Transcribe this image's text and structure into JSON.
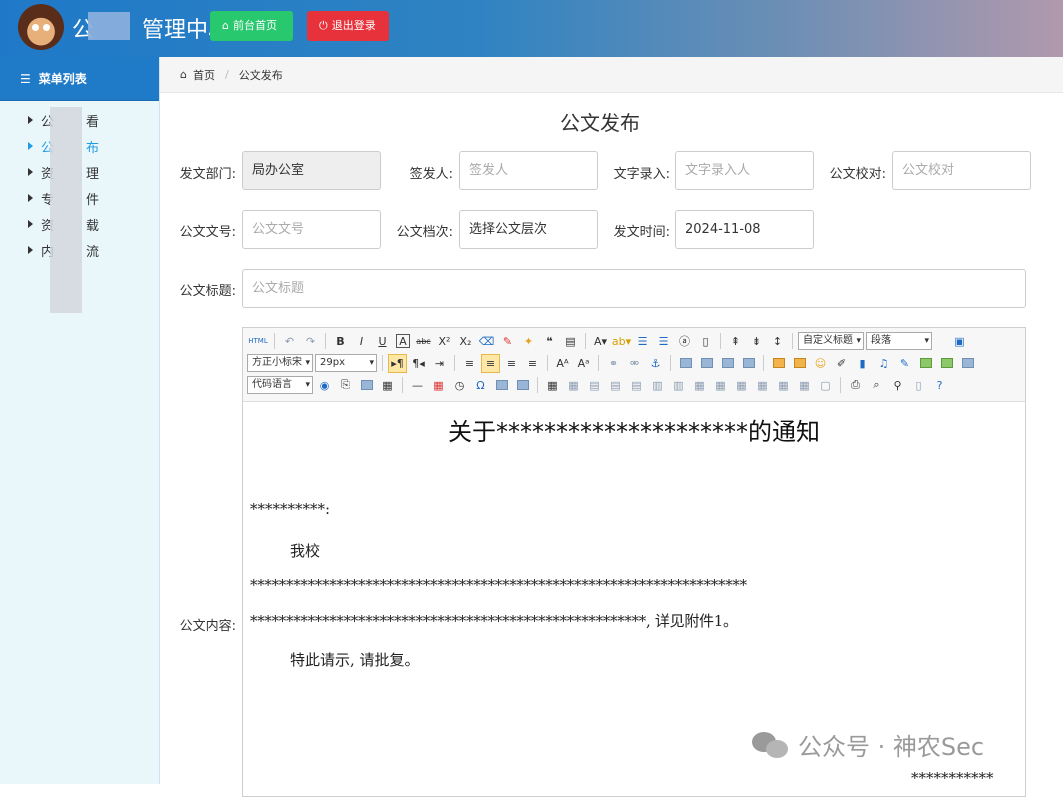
{
  "header": {
    "title_prefix": "公",
    "title_suffix": "管理中心",
    "home_button": "前台首页",
    "logout_button": "退出登录"
  },
  "sidebar": {
    "heading": "菜单列表",
    "items": [
      {
        "pre": "公",
        "post": "看"
      },
      {
        "pre": "公",
        "post": "布"
      },
      {
        "pre": "资",
        "post": "理"
      },
      {
        "pre": "专",
        "post": "件"
      },
      {
        "pre": "资",
        "post": "载"
      },
      {
        "pre": "内",
        "post": "流"
      }
    ]
  },
  "breadcrumb": {
    "home": "首页",
    "current": "公文发布"
  },
  "form": {
    "title": "公文发布",
    "dept_label": "发文部门:",
    "dept_value": "局办公室",
    "signer_label": "签发人:",
    "signer_placeholder": "签发人",
    "typist_label": "文字录入:",
    "typist_placeholder": "文字录入人",
    "proof_label": "公文校对:",
    "proof_placeholder": "公文校对",
    "docno_label": "公文文号:",
    "docno_placeholder": "公文文号",
    "level_label": "公文档次:",
    "level_value": "选择公文层次",
    "date_label": "发文时间:",
    "date_value": "2024-11-08",
    "subject_label": "公文标题:",
    "subject_placeholder": "公文标题",
    "content_label": "公文内容:"
  },
  "editor": {
    "font_family": "方正小标宋",
    "font_size": "29px",
    "custom_title": "自定义标题",
    "paragraph": "段落",
    "code_lang": "代码语言",
    "doc_title": "关于*********************的通知",
    "salutation": "**********:",
    "line1": "我校",
    "line2": "*********************************************************************",
    "line3": "*******************************************************, 详见附件1。",
    "line4": "特此请示, 请批复。",
    "line5": "***********"
  },
  "watermark": "公众号 · 神农Sec"
}
